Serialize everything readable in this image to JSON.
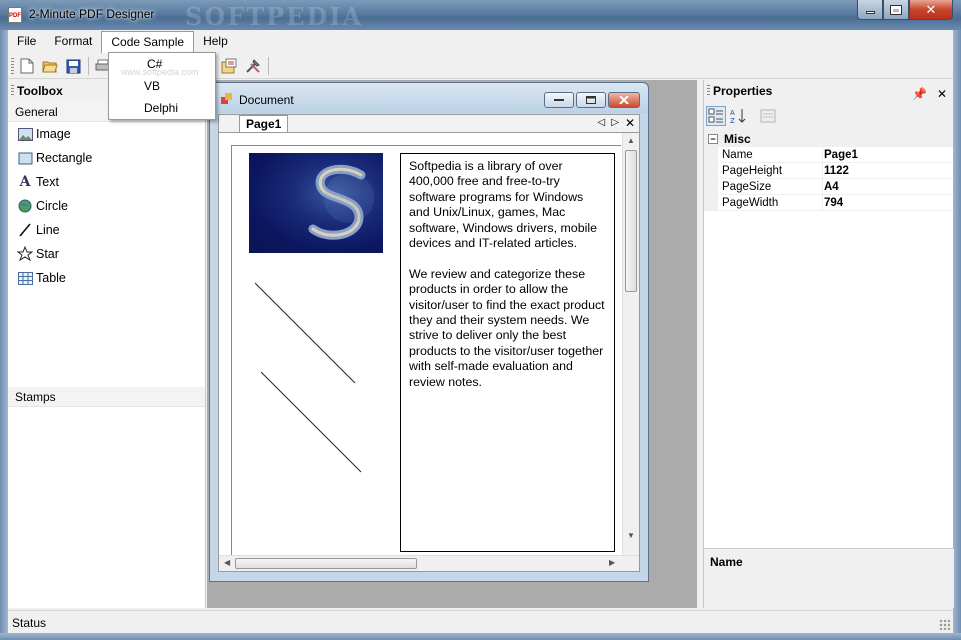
{
  "window": {
    "title": "2-Minute PDF Designer",
    "watermark": "SOFTPEDIA"
  },
  "menu": {
    "items": [
      "File",
      "Format",
      "Code Sample",
      "Help"
    ],
    "open": "Code Sample",
    "dropdown": [
      "C#",
      "VB",
      "Delphi"
    ],
    "dropdown_watermark": "www.softpedia.com"
  },
  "toolbox": {
    "title": "Toolbox",
    "general_label": "General",
    "items": [
      "Image",
      "Rectangle",
      "Text",
      "Circle",
      "Line",
      "Star",
      "Table"
    ],
    "stamps_label": "Stamps"
  },
  "document": {
    "title": "Document",
    "tab": "Page1",
    "text_paragraphs": [
      "Softpedia is a library of over 400,000 free and free-to-try software programs for Windows and Unix/Linux, games, Mac software, Windows drivers, mobile devices and IT-related articles.",
      "We review and categorize these products in order to allow the visitor/user to find the exact product they and their system needs. We strive to deliver only the best products to the visitor/user together with self-made evaluation and review notes."
    ]
  },
  "properties": {
    "title": "Properties",
    "category": "Misc",
    "rows": [
      {
        "name": "Name",
        "value": "Page1"
      },
      {
        "name": "PageHeight",
        "value": "1122"
      },
      {
        "name": "PageSize",
        "value": "A4"
      },
      {
        "name": "PageWidth",
        "value": "794"
      }
    ],
    "description_name": "Name"
  },
  "status": {
    "text": "Status"
  },
  "colors": {
    "titlebar": "#5d7fa3",
    "workspace": "#ababab",
    "doc_frame": "#c4d6e8"
  }
}
